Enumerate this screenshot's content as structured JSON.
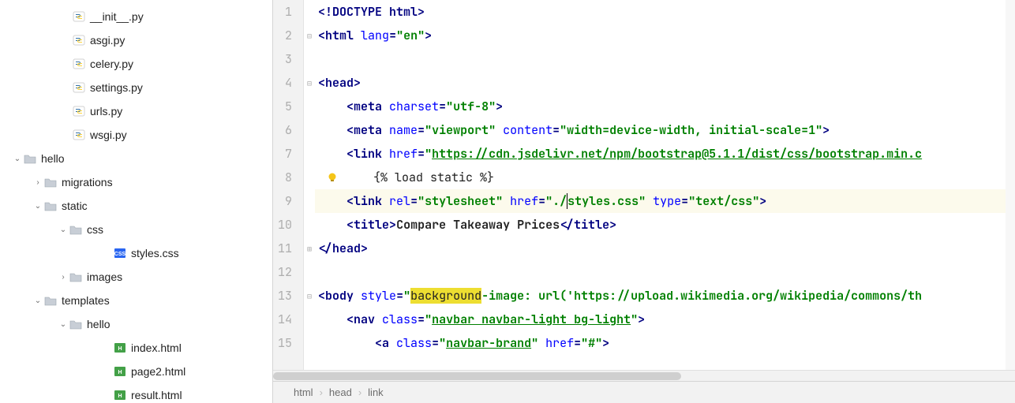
{
  "tree": [
    {
      "indent": 76,
      "chev": "",
      "icon": "py",
      "label": "__init__.py"
    },
    {
      "indent": 76,
      "chev": "",
      "icon": "py",
      "label": "asgi.py"
    },
    {
      "indent": 76,
      "chev": "",
      "icon": "py",
      "label": "celery.py"
    },
    {
      "indent": 76,
      "chev": "",
      "icon": "py",
      "label": "settings.py"
    },
    {
      "indent": 76,
      "chev": "",
      "icon": "py",
      "label": "urls.py"
    },
    {
      "indent": 76,
      "chev": "",
      "icon": "py",
      "label": "wsgi.py"
    },
    {
      "indent": 14,
      "chev": "down",
      "icon": "folder",
      "label": "hello"
    },
    {
      "indent": 40,
      "chev": "right",
      "icon": "folder",
      "label": "migrations"
    },
    {
      "indent": 40,
      "chev": "down",
      "icon": "folder",
      "label": "static"
    },
    {
      "indent": 72,
      "chev": "down",
      "icon": "folder",
      "label": "css"
    },
    {
      "indent": 128,
      "chev": "",
      "icon": "css",
      "label": "styles.css"
    },
    {
      "indent": 72,
      "chev": "right",
      "icon": "folder",
      "label": "images"
    },
    {
      "indent": 40,
      "chev": "down",
      "icon": "folder",
      "label": "templates"
    },
    {
      "indent": 72,
      "chev": "down",
      "icon": "folder",
      "label": "hello"
    },
    {
      "indent": 128,
      "chev": "",
      "icon": "html",
      "label": "index.html"
    },
    {
      "indent": 128,
      "chev": "",
      "icon": "html",
      "label": "page2.html"
    },
    {
      "indent": 128,
      "chev": "",
      "icon": "html",
      "label": "result.html"
    }
  ],
  "gutter": [
    "1",
    "2",
    "3",
    "4",
    "5",
    "6",
    "7",
    "8",
    "9",
    "10",
    "11",
    "12",
    "13",
    "14",
    "15"
  ],
  "fold": [
    "",
    "-",
    "",
    "-",
    "",
    "",
    "",
    "",
    "",
    "",
    "+",
    "",
    "-",
    "",
    "",
    ""
  ],
  "code": {
    "l1": {
      "a": "<!DOCTYPE ",
      "b": "html",
      "c": ">"
    },
    "l2": {
      "a": "<",
      "b": "html ",
      "c": "lang",
      "d": "=",
      "e": "\"en\"",
      "f": ">"
    },
    "l4": {
      "a": "<",
      "b": "head",
      "c": ">"
    },
    "l5": {
      "a": "    <",
      "b": "meta ",
      "c": "charset",
      "d": "=",
      "e": "\"utf-8\"",
      "f": ">"
    },
    "l6": {
      "a": "    <",
      "b": "meta ",
      "c": "name",
      "d": "=",
      "e": "\"viewport\" ",
      "f": "content",
      "g": "=",
      "h": "\"width=device-width, initial-scale=1\"",
      "i": ">"
    },
    "l7": {
      "a": "    <",
      "b": "link ",
      "c": "href",
      "d": "=",
      "e": "\"",
      "f": "https://cdn.jsdelivr.net/npm/bootstrap@5.1.1/dist/css/bootstrap.min.c"
    },
    "l8": {
      "a": "    {% load static %}"
    },
    "l9": {
      "a": "    <",
      "b": "link ",
      "c": "rel",
      "d": "=",
      "e": "\"stylesheet\" ",
      "f": "href",
      "g": "=",
      "h1": "\"./",
      "h2": "styles.css\" ",
      "i": "type",
      "j": "=",
      "k": "\"text/css\"",
      "l": ">"
    },
    "l10": {
      "a": "    <",
      "b": "title",
      "c": ">",
      "d": "Compare Takeaway Prices",
      "e": "</",
      "f": "title",
      "g": ">"
    },
    "l11": {
      "a": "</",
      "b": "head",
      "c": ">"
    },
    "l13": {
      "a": "<",
      "b": "body ",
      "c": "style",
      "d": "=",
      "e": "\"",
      "hl": "background",
      "f": "-image: url('https://upload.wikimedia.org/wikipedia/commons/th"
    },
    "l14": {
      "a": "    <",
      "b": "nav ",
      "c": "class",
      "d": "=",
      "e": "\"",
      "f": "navbar navbar-light bg-light",
      "g": "\"",
      "h": ">"
    },
    "l15": {
      "a": "        <",
      "b": "a ",
      "c": "class",
      "d": "=",
      "e": "\"",
      "f": "navbar-brand",
      "g": "\" ",
      "h": "href",
      "i": "=",
      "j": "\"#\"",
      "k": ">"
    }
  },
  "breadcrumbs": {
    "a": "html",
    "b": "head",
    "c": "link"
  }
}
